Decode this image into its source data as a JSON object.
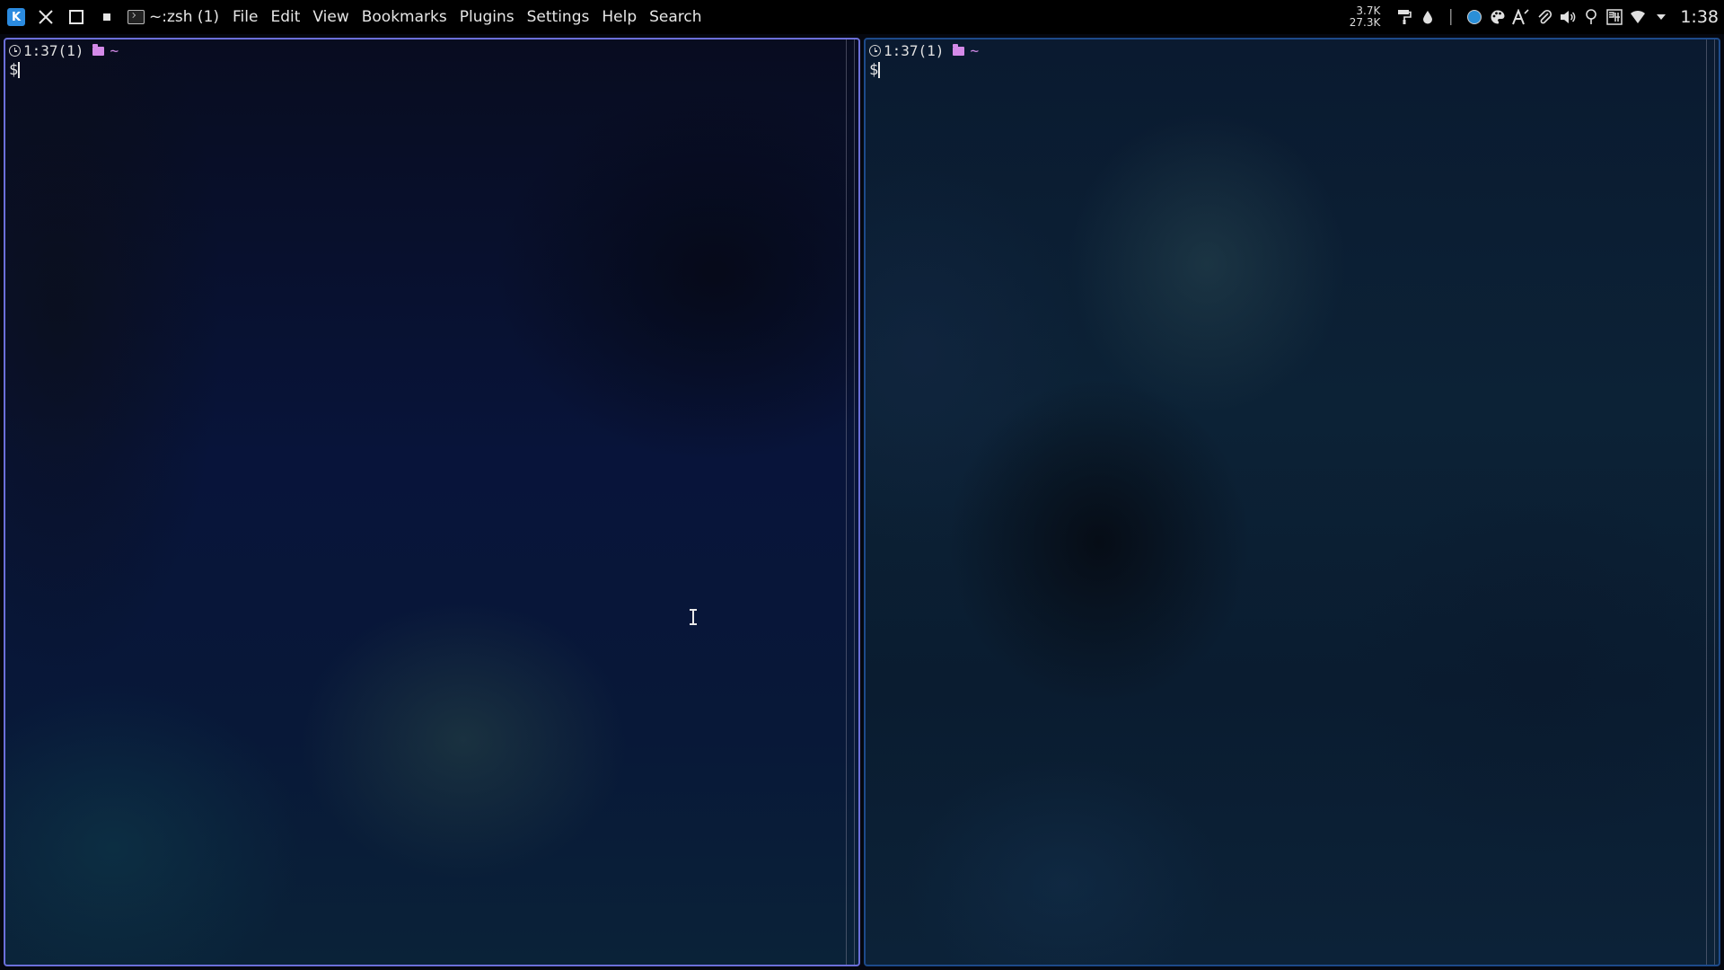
{
  "topbar": {
    "app_logo": "kde-logo-icon",
    "close_icon": "close-icon",
    "maximize_icon": "maximize-icon",
    "minimize_icon": "minimize-icon",
    "window_title": "~:zsh (1)",
    "menu": [
      "File",
      "Edit",
      "View",
      "Bookmarks",
      "Plugins",
      "Settings",
      "Help",
      "Search"
    ],
    "netspeed_up": "3.7K",
    "netspeed_down": "27.3K",
    "tray_icons": [
      "paint-roller-icon",
      "droplet-icon",
      "blue-circle-icon",
      "palette-icon",
      "text-style-icon",
      "paperclip-icon",
      "volume-icon",
      "location-pin-icon",
      "keyboard-layout-icon",
      "wifi-icon",
      "tray-expand-icon"
    ],
    "clock": "1:38"
  },
  "panes": [
    {
      "time": "1:37(1)",
      "dir": "~",
      "prompt": "$",
      "border_color": "#6b6fd9"
    },
    {
      "time": "1:37(1)",
      "dir": "~",
      "prompt": "$",
      "border_color": "#1d4a8a"
    }
  ]
}
